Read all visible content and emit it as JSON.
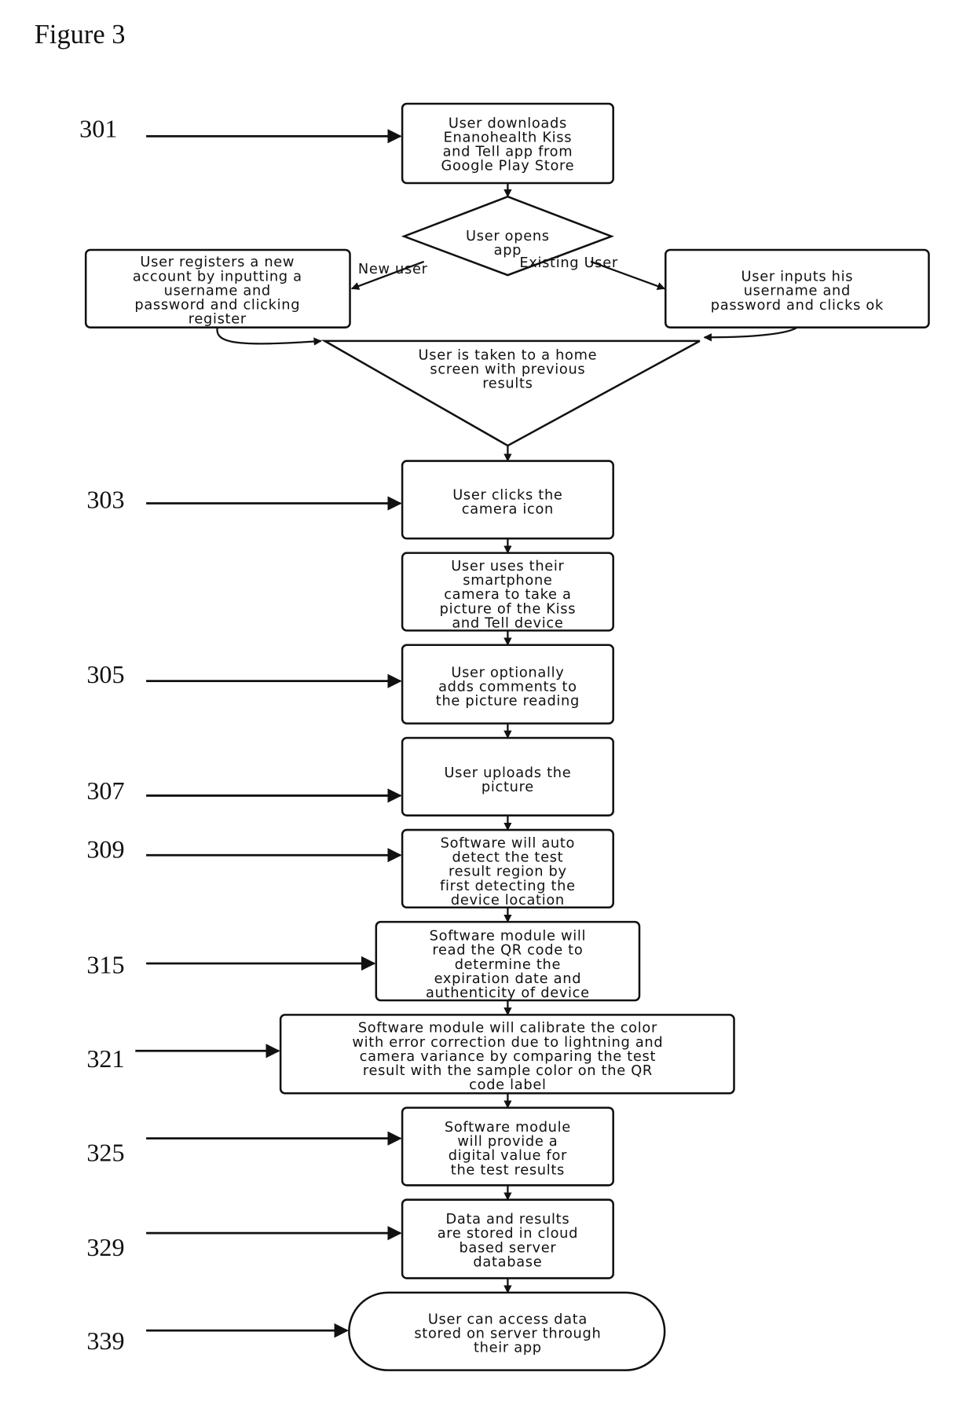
{
  "figure": {
    "title": "Figure 3"
  },
  "nodes": [
    {
      "id": "download",
      "shape": "rect",
      "lines": [
        "User downloads",
        "Enanohealth Kiss",
        "and Tell app from",
        "Google Play Store"
      ]
    },
    {
      "id": "open",
      "shape": "diamond",
      "lines": [
        "User opens",
        "app"
      ]
    },
    {
      "id": "register",
      "shape": "rect",
      "lines": [
        "User registers a new",
        "account by inputting a",
        "username and",
        "password and clicking",
        "register"
      ]
    },
    {
      "id": "login",
      "shape": "rect",
      "lines": [
        "User inputs his",
        "username and",
        "password and clicks ok"
      ]
    },
    {
      "id": "home",
      "shape": "triangle",
      "lines": [
        "User is taken to a home",
        "screen with previous",
        "results"
      ]
    },
    {
      "id": "camera-icon",
      "shape": "rect",
      "lines": [
        "User clicks the",
        "camera icon"
      ]
    },
    {
      "id": "take-picture",
      "shape": "rect",
      "lines": [
        "User uses their",
        "smartphone",
        "camera to take a",
        "picture of the Kiss",
        "and Tell device"
      ]
    },
    {
      "id": "comments",
      "shape": "rect",
      "lines": [
        "User optionally",
        "adds comments to",
        "the picture reading"
      ]
    },
    {
      "id": "upload",
      "shape": "rect",
      "lines": [
        "User uploads the",
        "picture"
      ]
    },
    {
      "id": "auto-detect",
      "shape": "rect",
      "lines": [
        "Software will auto",
        "detect the test",
        "result region by",
        "first detecting the",
        "device location"
      ]
    },
    {
      "id": "qr-read",
      "shape": "rect",
      "lines": [
        "Software module will",
        "read the QR code to",
        "determine the",
        "expiration date and",
        "authenticity of device"
      ]
    },
    {
      "id": "calibrate",
      "shape": "rect",
      "lines": [
        "Software module will calibrate the color",
        "with error correction due to lightning and",
        "camera variance by comparing the test",
        "result with the sample color on the QR",
        "code label"
      ]
    },
    {
      "id": "digital-value",
      "shape": "rect",
      "lines": [
        "Software module",
        "will provide a",
        "digital value for",
        "the test results"
      ]
    },
    {
      "id": "cloud-store",
      "shape": "rect",
      "lines": [
        "Data and results",
        "are stored in cloud",
        "based server",
        "database"
      ]
    },
    {
      "id": "access-data",
      "shape": "terminator",
      "lines": [
        "User can access data",
        "stored on server through",
        "their app"
      ]
    }
  ],
  "edge_labels": {
    "new_user": "New user",
    "existing_user": "Existing User"
  },
  "reference_numerals": [
    {
      "label": "301",
      "target": "download"
    },
    {
      "label": "303",
      "target": "camera-icon"
    },
    {
      "label": "305",
      "target": "comments"
    },
    {
      "label": "307",
      "target": "upload"
    },
    {
      "label": "309",
      "target": "auto-detect"
    },
    {
      "label": "315",
      "target": "qr-read"
    },
    {
      "label": "321",
      "target": "calibrate"
    },
    {
      "label": "325",
      "target": "digital-value"
    },
    {
      "label": "329",
      "target": "cloud-store"
    },
    {
      "label": "339",
      "target": "access-data"
    }
  ],
  "colors": {
    "ink": "#111111",
    "background": "#ffffff"
  }
}
